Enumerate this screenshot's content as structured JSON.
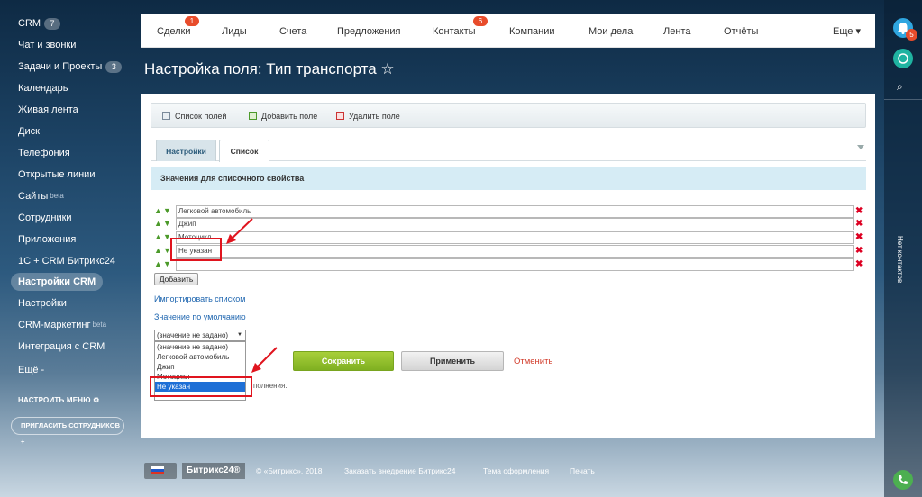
{
  "sidebar": {
    "items": [
      {
        "label": "CRM",
        "badge": "7"
      },
      {
        "label": "Чат и звонки"
      },
      {
        "label": "Задачи и Проекты",
        "badge": "3"
      },
      {
        "label": "Календарь"
      },
      {
        "label": "Живая лента"
      },
      {
        "label": "Диск"
      },
      {
        "label": "Телефония"
      },
      {
        "label": "Открытые линии"
      },
      {
        "label": "Сайты",
        "beta": "beta"
      },
      {
        "label": "Сотрудники"
      },
      {
        "label": "Приложения"
      },
      {
        "label": "1С + CRM Битрикс24"
      },
      {
        "label": "Настройки CRM"
      },
      {
        "label": "Настройки"
      },
      {
        "label": "CRM-маркетинг",
        "beta": "beta"
      },
      {
        "label": "Интеграция с CRM"
      },
      {
        "label": "Ещё -"
      }
    ],
    "configure_menu": "НАСТРОИТЬ МЕНЮ",
    "invite": "ПРИГЛАСИТЬ СОТРУДНИКОВ"
  },
  "topnav": {
    "items": [
      {
        "label": "Сделки",
        "counter": "1"
      },
      {
        "label": "Лиды"
      },
      {
        "label": "Счета"
      },
      {
        "label": "Предложения"
      },
      {
        "label": "Контакты",
        "counter": "6"
      },
      {
        "label": "Компании"
      },
      {
        "label": "Мои дела"
      },
      {
        "label": "Лента"
      },
      {
        "label": "Отчёты"
      },
      {
        "label": "Еще ▾"
      }
    ]
  },
  "page": {
    "title": "Настройка поля: Тип транспорта ☆"
  },
  "toolbar": {
    "list_fields": "Список полей",
    "add_field": "Добавить поле",
    "delete_field": "Удалить поле"
  },
  "tabs": [
    {
      "label": "Настройки"
    },
    {
      "label": "Список"
    }
  ],
  "section": {
    "title": "Значения для списочного свойства"
  },
  "values": [
    {
      "value": "Легковой автомобиль"
    },
    {
      "value": "Джип"
    },
    {
      "value": "Мотоцикл"
    },
    {
      "value": "Не указан"
    },
    {
      "value": ""
    }
  ],
  "add_button": "Добавить",
  "import_link": "Импортировать списком",
  "default_link": "Значение по умолчанию",
  "default_select": {
    "value": "(значение не задано)",
    "options": [
      "(значение не задано)",
      "Легковой автомобиль",
      "Джип",
      "Мотоцикл",
      "Не указан"
    ],
    "selected_index": 4
  },
  "hint_text": "полнения.",
  "buttons": {
    "save": "Сохранить",
    "apply": "Применить",
    "cancel": "Отменить"
  },
  "rightbar": {
    "notifications_count": "5",
    "no_contacts": "Нет контактов"
  },
  "footer": {
    "brand": "Битрикс24®",
    "copyright": "© «Битрикс», 2018",
    "order": "Заказать внедрение Битрикс24",
    "theme": "Тема оформления",
    "print": "Печать"
  },
  "colors": {
    "accent_green": "#7fb021",
    "link": "#2067b0",
    "annotation_red": "#e0141e"
  }
}
